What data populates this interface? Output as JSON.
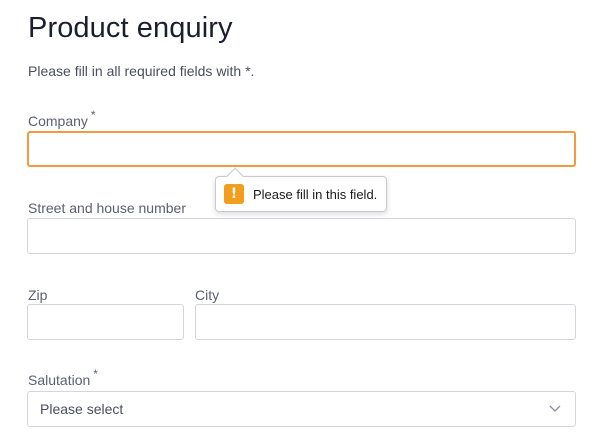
{
  "form": {
    "title": "Product enquiry",
    "intro": "Please fill in all required fields with *.",
    "required_marker": "*",
    "company": {
      "label": "Company",
      "required": true,
      "value": ""
    },
    "street": {
      "label": "Street and house number",
      "required": false,
      "value": ""
    },
    "zip": {
      "label": "Zip",
      "required": false,
      "value": ""
    },
    "city": {
      "label": "City",
      "required": false,
      "value": ""
    },
    "salutation": {
      "label": "Salutation",
      "required": true,
      "selected": "Please select"
    }
  },
  "validation_tooltip": {
    "message": "Please fill in this field.",
    "icon": "warning-icon",
    "icon_glyph": "!"
  },
  "colors": {
    "focus_border": "#f39a3d",
    "warning": "#f29d1b",
    "field_border": "#d4d6dc"
  }
}
